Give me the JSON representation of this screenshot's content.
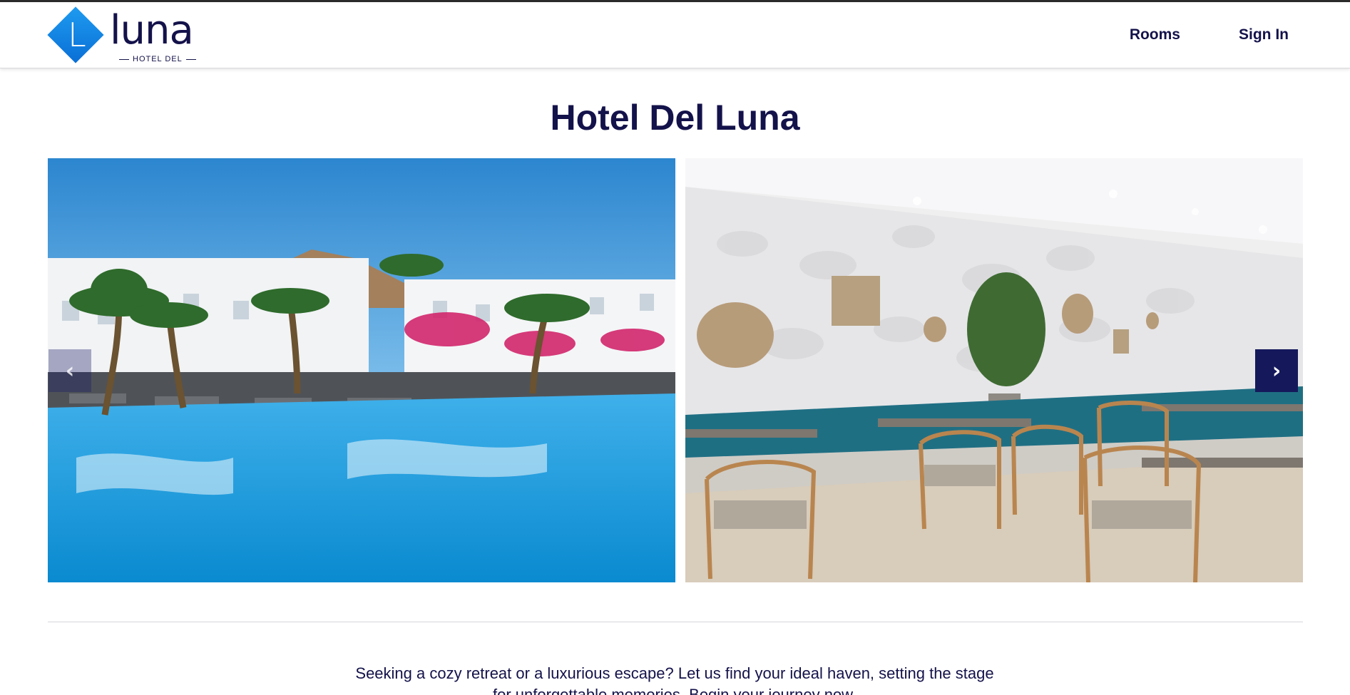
{
  "header": {
    "logo": {
      "letter": "L",
      "word": "luna",
      "subtitle": "HOTEL DEL",
      "colors": {
        "diamond": "#0a7fe6",
        "text": "#14124a"
      }
    },
    "nav": [
      {
        "label": "Rooms"
      },
      {
        "label": "Sign In"
      }
    ]
  },
  "main": {
    "title": "Hotel Del Luna",
    "carousel": {
      "slides": [
        {
          "name": "pool-courtyard-photo"
        },
        {
          "name": "restaurant-dining-photo"
        }
      ],
      "prev_icon": "chevron-left-icon",
      "next_icon": "chevron-right-icon"
    },
    "tagline": "Seeking a cozy retreat or a luxurious escape? Let us find your ideal haven, setting the stage for unforgettable memories. Begin your journey now."
  },
  "colors": {
    "brand_navy": "#14124a",
    "accent_blue": "#0a7fe6",
    "arrow_bg": "#15195c"
  }
}
